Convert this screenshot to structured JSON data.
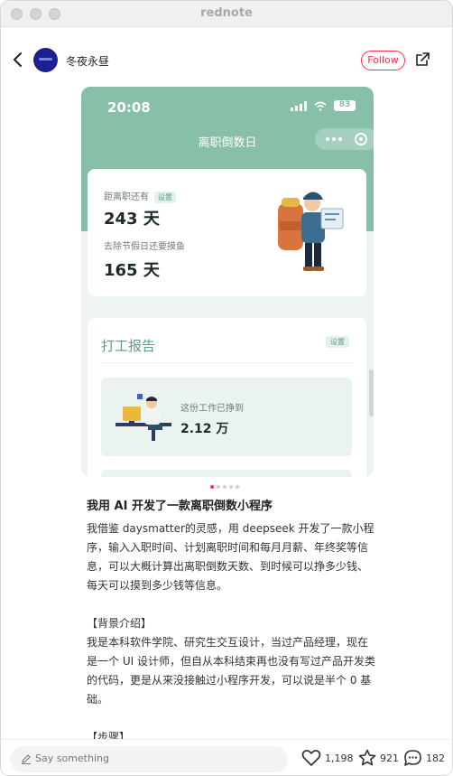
{
  "window": {
    "title": "rednote"
  },
  "header": {
    "author": "冬夜永昼",
    "follow_label": "Follow"
  },
  "screenshot": {
    "status_time": "20:08",
    "battery": "83",
    "app_title": "离职倒数日",
    "card1": {
      "label1": "距离职还有",
      "tag1": "设置",
      "days1": "243 天",
      "label2": "去除节假日还要摸鱼",
      "days2": "165 天"
    },
    "card2": {
      "title": "打工报告",
      "tag": "设置",
      "earned_label": "这份工作已挣到",
      "earned_value": "2.12 万"
    }
  },
  "pager": {
    "count": 5,
    "active": 1
  },
  "post": {
    "title": "我用 AI 开发了一款离职倒数小程序",
    "paragraphs": [
      "我借鉴 daysmatter的灵感，用 deepseek 开发了一款小程序，输入入职时间、计划离职时间和每月月薪、年终奖等信息，可以大概计算出离职倒数天数、到时候可以挣多少钱、每天可以摸到多少钱等信息。",
      "我是本科软件学院、研究生交互设计，当过产品经理，现在是一个 UI 设计师，但自从本科结束再也没有写过产品开发类的代码，更是从来没接触过小程序开发，可以说是半个 0 基础。"
    ],
    "section_background": "【背景介绍】",
    "section_steps": "【步骤】"
  },
  "bottombar": {
    "comment_placeholder": "Say something",
    "likes": "1,198",
    "stars": "921",
    "comments": "182"
  },
  "colors": {
    "brand_red": "#ff2e4d",
    "app_green": "#87bfa9"
  }
}
